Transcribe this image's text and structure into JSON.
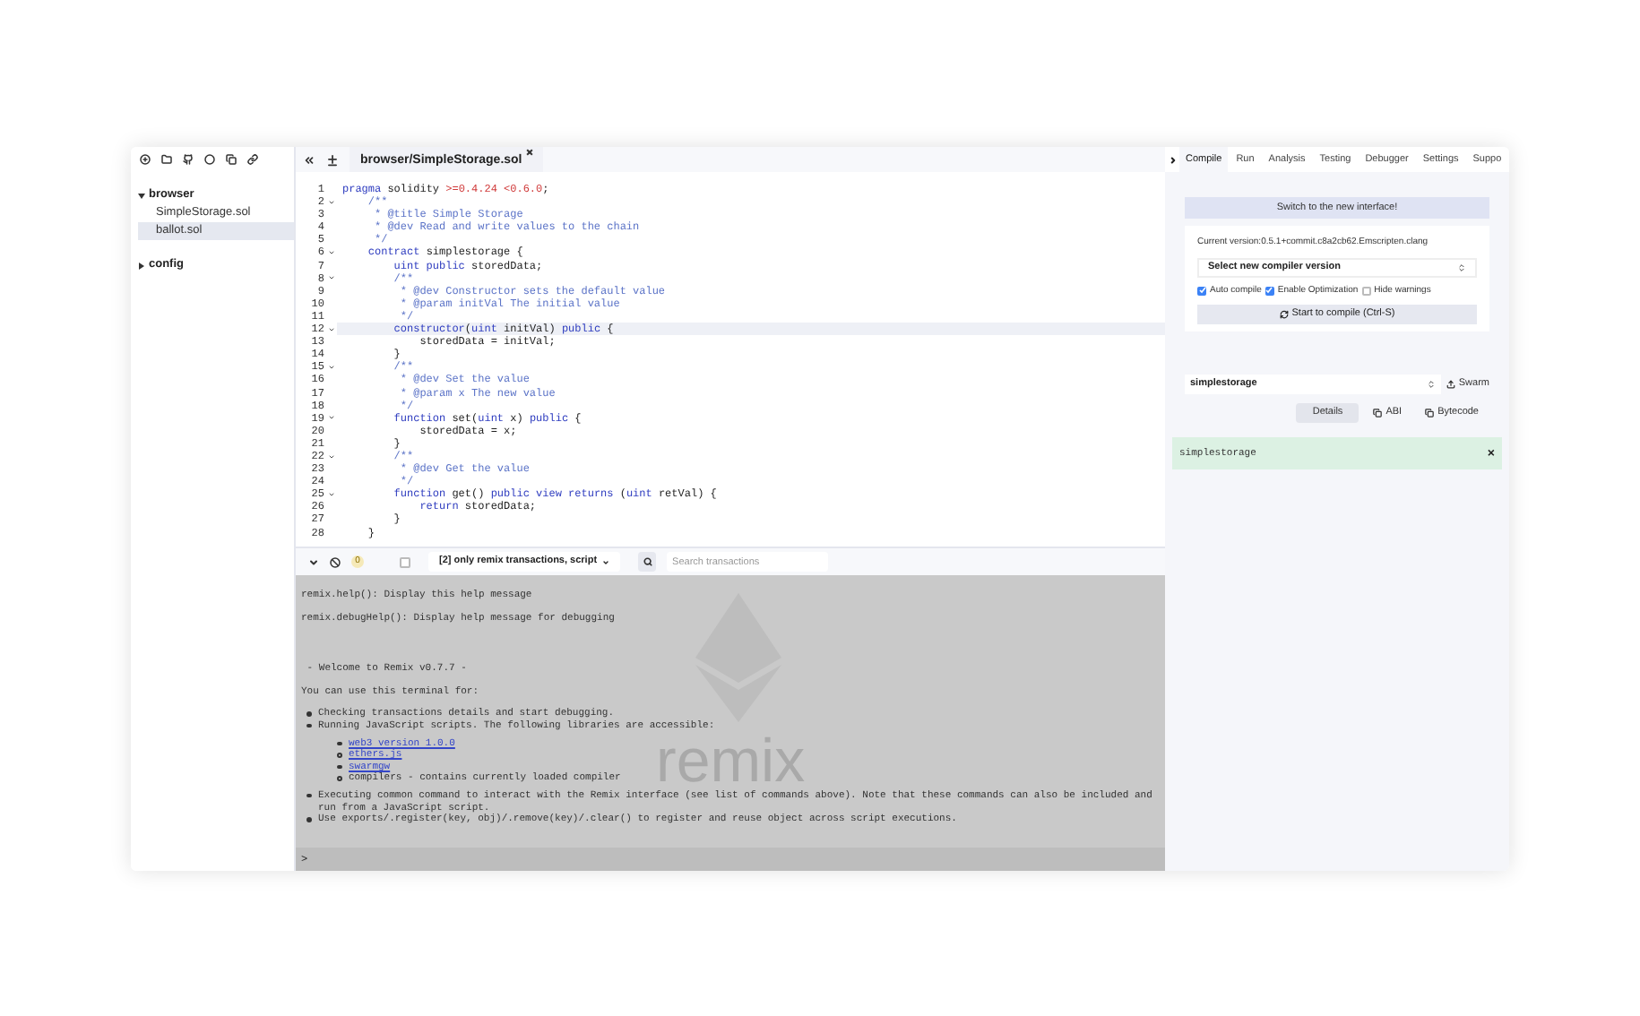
{
  "file_panel": {
    "tree": [
      {
        "label": "browser",
        "expanded": true,
        "selected": false,
        "children": [
          {
            "label": "SimpleStorage.sol",
            "selected": false
          },
          {
            "label": "ballot.sol",
            "selected": true
          }
        ]
      },
      {
        "label": "config",
        "expanded": false,
        "selected": false
      }
    ]
  },
  "editor": {
    "tab": "browser/SimpleStorage.sol",
    "lines": [
      {
        "n": "1",
        "fold": false,
        "active": false,
        "tokens": [
          {
            "kind": "kw",
            "t": "pragma"
          },
          {
            "kind": "tx",
            "t": " solidity "
          },
          {
            "kind": "num",
            "t": ">=0.4.24 <0.6.0"
          },
          {
            "kind": "tx",
            "t": ";"
          }
        ]
      },
      {
        "n": "2",
        "fold": true,
        "active": false,
        "tokens": [
          {
            "kind": "cm",
            "t": "    /**"
          }
        ]
      },
      {
        "n": "3",
        "fold": false,
        "active": false,
        "tokens": [
          {
            "kind": "cm",
            "t": "     * @title Simple Storage"
          }
        ]
      },
      {
        "n": "4",
        "fold": false,
        "active": false,
        "tokens": [
          {
            "kind": "cm",
            "t": "     * @dev Read and write values to the chain"
          }
        ]
      },
      {
        "n": "5",
        "fold": false,
        "active": false,
        "tokens": [
          {
            "kind": "cm",
            "t": "     */"
          }
        ]
      },
      {
        "n": "6",
        "fold": true,
        "active": false,
        "tokens": [
          {
            "kind": "kw",
            "t": "    contract"
          },
          {
            "kind": "tx",
            "t": " simplestorage {"
          }
        ]
      },
      {
        "n": "7",
        "fold": false,
        "active": false,
        "tokens": [
          {
            "kind": "kw",
            "t": "        uint public"
          },
          {
            "kind": "tx",
            "t": " storedData;"
          }
        ]
      },
      {
        "n": "8",
        "fold": true,
        "active": false,
        "tokens": [
          {
            "kind": "cm",
            "t": "        /**"
          }
        ]
      },
      {
        "n": "9",
        "fold": false,
        "active": false,
        "tokens": [
          {
            "kind": "cm",
            "t": "         * @dev Constructor sets the default value"
          }
        ]
      },
      {
        "n": "10",
        "fold": false,
        "active": false,
        "tokens": [
          {
            "kind": "cm",
            "t": "         * @param initVal The initial value"
          }
        ]
      },
      {
        "n": "11",
        "fold": false,
        "active": false,
        "tokens": [
          {
            "kind": "cm",
            "t": "         */"
          }
        ]
      },
      {
        "n": "12",
        "fold": true,
        "active": true,
        "tokens": [
          {
            "kind": "kw",
            "t": "        constructor"
          },
          {
            "kind": "tx",
            "t": "("
          },
          {
            "kind": "kw",
            "t": "uint"
          },
          {
            "kind": "tx",
            "t": " initVal) "
          },
          {
            "kind": "kw",
            "t": "public"
          },
          {
            "kind": "tx",
            "t": " {"
          }
        ]
      },
      {
        "n": "13",
        "fold": false,
        "active": false,
        "tokens": [
          {
            "kind": "tx",
            "t": "            storedData = initVal;"
          }
        ]
      },
      {
        "n": "14",
        "fold": false,
        "active": false,
        "tokens": [
          {
            "kind": "tx",
            "t": "        }"
          }
        ]
      },
      {
        "n": "15",
        "fold": true,
        "active": false,
        "tokens": [
          {
            "kind": "cm",
            "t": "        /**"
          }
        ]
      },
      {
        "n": "16",
        "fold": false,
        "active": false,
        "tokens": [
          {
            "kind": "cm",
            "t": "         * @dev Set the value"
          }
        ]
      },
      {
        "n": "17",
        "fold": false,
        "active": false,
        "tokens": [
          {
            "kind": "cm",
            "t": "         * @param x The new value"
          }
        ]
      },
      {
        "n": "18",
        "fold": false,
        "active": false,
        "tokens": [
          {
            "kind": "cm",
            "t": "         */"
          }
        ]
      },
      {
        "n": "19",
        "fold": true,
        "active": false,
        "tokens": [
          {
            "kind": "kw",
            "t": "        function"
          },
          {
            "kind": "tx",
            "t": " set("
          },
          {
            "kind": "kw",
            "t": "uint"
          },
          {
            "kind": "tx",
            "t": " x) "
          },
          {
            "kind": "kw",
            "t": "public"
          },
          {
            "kind": "tx",
            "t": " {"
          }
        ]
      },
      {
        "n": "20",
        "fold": false,
        "active": false,
        "tokens": [
          {
            "kind": "tx",
            "t": "            storedData = x;"
          }
        ]
      },
      {
        "n": "21",
        "fold": false,
        "active": false,
        "tokens": [
          {
            "kind": "tx",
            "t": "        }"
          }
        ]
      },
      {
        "n": "22",
        "fold": true,
        "active": false,
        "tokens": [
          {
            "kind": "cm",
            "t": "        /**"
          }
        ]
      },
      {
        "n": "23",
        "fold": false,
        "active": false,
        "tokens": [
          {
            "kind": "cm",
            "t": "         * @dev Get the value"
          }
        ]
      },
      {
        "n": "24",
        "fold": false,
        "active": false,
        "tokens": [
          {
            "kind": "cm",
            "t": "         */"
          }
        ]
      },
      {
        "n": "25",
        "fold": true,
        "active": false,
        "tokens": [
          {
            "kind": "kw",
            "t": "        function"
          },
          {
            "kind": "tx",
            "t": " get() "
          },
          {
            "kind": "kw",
            "t": "public view returns"
          },
          {
            "kind": "tx",
            "t": " ("
          },
          {
            "kind": "kw",
            "t": "uint"
          },
          {
            "kind": "tx",
            "t": " retVal) {"
          }
        ]
      },
      {
        "n": "26",
        "fold": false,
        "active": false,
        "tokens": [
          {
            "kind": "kw",
            "t": "            return"
          },
          {
            "kind": "tx",
            "t": " storedData;"
          }
        ]
      },
      {
        "n": "27",
        "fold": false,
        "active": false,
        "tokens": [
          {
            "kind": "tx",
            "t": "        }"
          }
        ]
      },
      {
        "n": "28",
        "fold": false,
        "active": false,
        "tokens": [
          {
            "kind": "tx",
            "t": "    }"
          }
        ]
      }
    ]
  },
  "terminal_toolbar": {
    "count": "0",
    "listen_checked": false,
    "filter": "[2] only remix transactions, script",
    "search": {
      "placeholder": "Search transactions"
    }
  },
  "terminal": {
    "logo_text": "remix",
    "lines": [
      {
        "kind": "text",
        "text": "remix.help(): Display this help message"
      },
      {
        "kind": "text",
        "text": "remix.debugHelp(): Display help message for debugging"
      },
      {
        "kind": "heading",
        "text": " - Welcome to Remix v0.7.7 -"
      },
      {
        "kind": "text",
        "text": "You can use this terminal for:"
      }
    ],
    "bullets": [
      {
        "text": "Checking transactions details and start debugging."
      },
      {
        "text": "Running JavaScript scripts. The following libraries are accessible:",
        "children": [
          {
            "text": "web3 version 1.0.0",
            "link": true
          },
          {
            "text": "ethers.js",
            "link": true
          },
          {
            "text": "swarmgw",
            "link": true
          },
          {
            "text": "compilers - contains currently loaded compiler",
            "link": false
          }
        ]
      },
      {
        "text": "Executing common command to interact with the Remix interface (see list of commands above). Note that these commands can also be included and run from a JavaScript script."
      },
      {
        "text": "Use exports/.register(key, obj)/.remove(key)/.clear() to register and reuse object across script executions."
      }
    ],
    "prompt": ">"
  },
  "right_panel": {
    "tabs": [
      {
        "label": "Compile",
        "selected": true
      },
      {
        "label": "Run",
        "selected": false
      },
      {
        "label": "Analysis",
        "selected": false
      },
      {
        "label": "Testing",
        "selected": false
      },
      {
        "label": "Debugger",
        "selected": false
      },
      {
        "label": "Settings",
        "selected": false
      },
      {
        "label": "Suppo",
        "selected": false
      }
    ],
    "switch_banner": "Switch to the new interface!",
    "current_version": "Current version:0.5.1+commit.c8a2cb62.Emscripten.clang",
    "compiler_select": "Select new compiler version",
    "options": [
      {
        "label": "Auto compile",
        "checked": true
      },
      {
        "label": "Enable Optimization",
        "checked": true
      },
      {
        "label": "Hide warnings",
        "checked": false
      }
    ],
    "compile_button": "Start to compile (Ctrl-S)",
    "contract_select": "simplestorage",
    "swarm_button": "Swarm",
    "detail_buttons": [
      {
        "label": "Details",
        "selected": true
      },
      {
        "label": "ABI",
        "selected": false
      },
      {
        "label": "Bytecode",
        "selected": false
      }
    ],
    "result": {
      "text": "simplestorage",
      "close": "×"
    }
  }
}
